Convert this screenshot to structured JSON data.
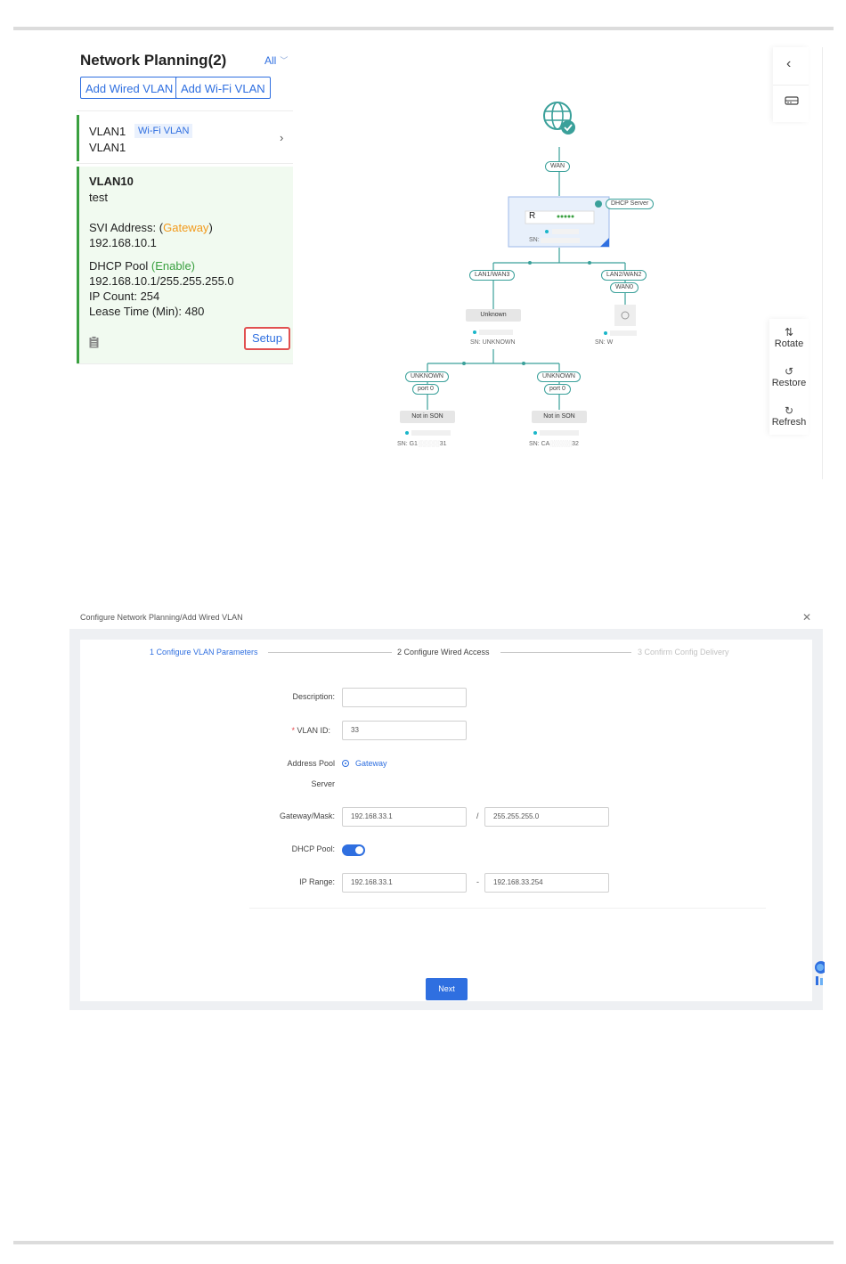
{
  "top_panel": {
    "title": "Network Planning(2)",
    "filter_label": "All",
    "add_wired_vlan": "Add Wired VLAN",
    "add_wifi_vlan": "Add Wi-Fi VLAN",
    "vlan1": {
      "name": "VLAN1",
      "tag": "Wi-Fi VLAN",
      "desc": "VLAN1"
    },
    "vlan10": {
      "name": "VLAN10",
      "desc": "test",
      "svi_label": "SVI Address:",
      "svi_open": "(",
      "svi_mode": "Gateway",
      "svi_close": ")",
      "svi_ip": "192.168.10.1",
      "dhcp_label": "DHCP Pool",
      "dhcp_state": "(Enable)",
      "dhcp_range": "192.168.10.1/255.255.255.0",
      "ip_count": "IP Count: 254",
      "lease": "Lease Time (Min): 480",
      "setup": "Setup"
    }
  },
  "topology": {
    "wan": "WAN",
    "dhcp_server": "DHCP Server",
    "router_label": "R",
    "router_sn": "SN:",
    "lan1": "LAN1/WAN3",
    "lan2": "LAN2/WAN2",
    "wan0": "WAN0",
    "unknown_device": "Unknown",
    "sn_unknown": "SN: UNKNOWN",
    "sn_ap": "SN: W",
    "unknown1": "UNKNOWN",
    "unknown2": "UNKNOWN",
    "port1": "port 0",
    "port2": "port 0",
    "not_in_son1": "Not in SON",
    "not_in_son2": "Not in SON",
    "sn_sw1": "SN: G1",
    "sn_sw1_tail": "31",
    "sn_sw2": "SN: CA",
    "sn_sw2_tail": "32"
  },
  "tools": {
    "rotate": "Rotate",
    "restore": "Restore",
    "refresh": "Refresh"
  },
  "dialog": {
    "title": "Configure Network Planning/Add Wired VLAN",
    "steps": [
      "1 Configure VLAN Parameters",
      "2 Configure Wired Access",
      "3 Confirm Config Delivery"
    ],
    "description_label": "Description:",
    "description_value": "",
    "vlan_id_label": "VLAN ID:",
    "vlan_id_value": "33",
    "address_pool_label": "Address Pool",
    "address_pool_label2": "Server",
    "address_pool_option": "Gateway",
    "gateway_mask_label": "Gateway/Mask:",
    "gateway_value": "192.168.33.1",
    "mask_sep": "/",
    "mask_value": "255.255.255.0",
    "dhcp_pool_label": "DHCP Pool:",
    "ip_range_label": "IP Range:",
    "ip_start": "192.168.33.1",
    "range_sep": "-",
    "ip_end": "192.168.33.254",
    "next": "Next"
  },
  "colors": {
    "primary": "#2f6fe0",
    "green": "#3aa040",
    "orange": "#f29a1c",
    "highlight": "#e15050"
  }
}
